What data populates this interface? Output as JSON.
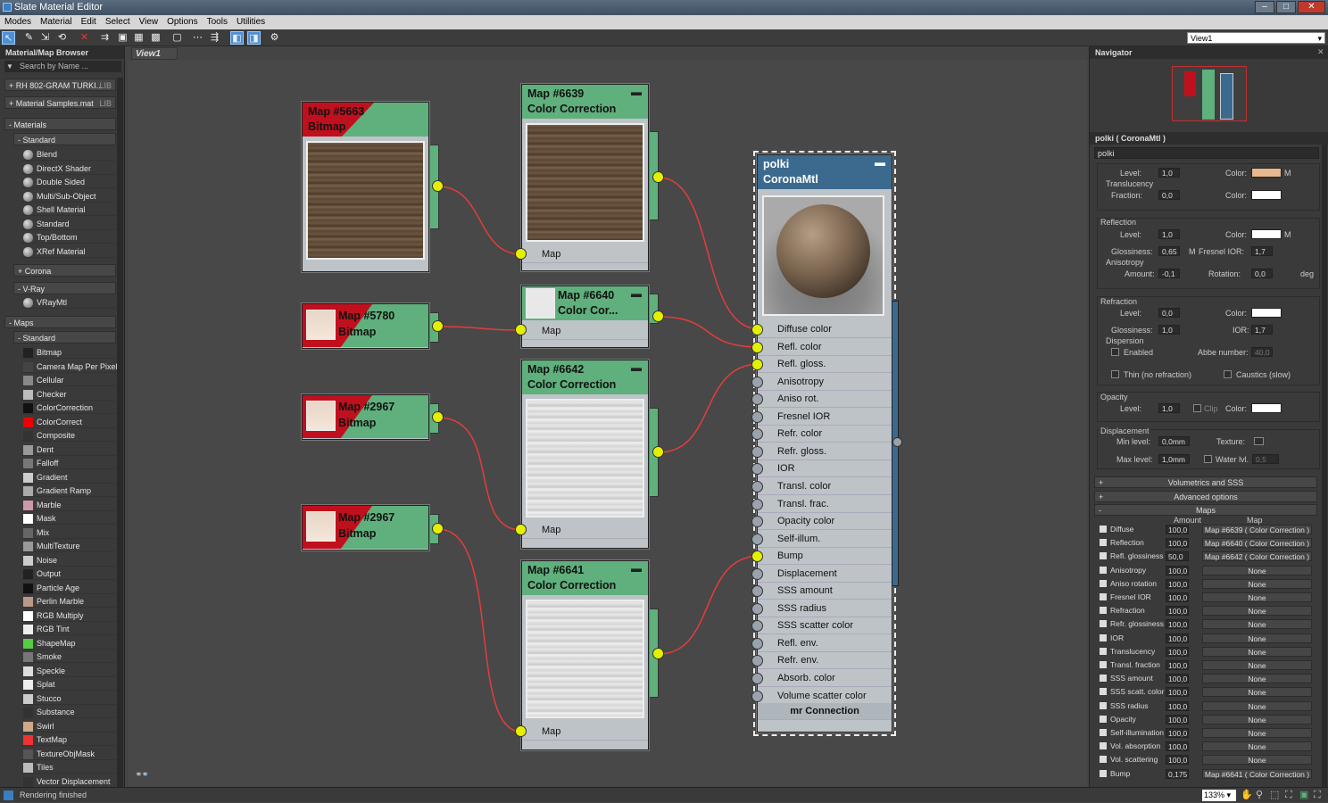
{
  "window": {
    "title": "Slate Material Editor"
  },
  "menu": [
    "Modes",
    "Material",
    "Edit",
    "Select",
    "View",
    "Options",
    "Tools",
    "Utilities"
  ],
  "view_select": "View1",
  "view_tab": "View1",
  "browser": {
    "title": "Material/Map Browser",
    "search_placeholder": "Search by Name ...",
    "libs": [
      {
        "label": "+ RH 802-GRAM TURKI...",
        "tag": "LIB"
      },
      {
        "label": "+ Material Samples.mat",
        "tag": "LIB"
      }
    ],
    "materials_header": "- Materials",
    "standard_header": "- Standard",
    "materials": [
      "Blend",
      "DirectX Shader",
      "Double Sided",
      "Multi/Sub-Object",
      "Shell Material",
      "Standard",
      "Top/Bottom",
      "XRef Material"
    ],
    "corona_header": "+ Corona",
    "vray_header": "- V-Ray",
    "vray_items": [
      "VRayMtl"
    ],
    "maps_header": "- Maps",
    "maps_standard_header": "- Standard",
    "maps": [
      "Bitmap",
      "Camera Map Per Pixel",
      "Cellular",
      "Checker",
      "ColorCorrection",
      "ColorCorrect",
      "Composite",
      "Dent",
      "Falloff",
      "Gradient",
      "Gradient Ramp",
      "Marble",
      "Mask",
      "Mix",
      "MultiTexture",
      "Noise",
      "Output",
      "Particle Age",
      "Perlin Marble",
      "RGB Multiply",
      "RGB Tint",
      "ShapeMap",
      "Smoke",
      "Speckle",
      "Splat",
      "Stucco",
      "Substance",
      "Swirl",
      "TextMap",
      "TextureObjMask",
      "Tiles",
      "Vector Displacement"
    ]
  },
  "nodes": {
    "n5663": {
      "line1": "Map #5663",
      "line2": "Bitmap"
    },
    "n5780": {
      "line1": "Map #5780",
      "line2": "Bitmap"
    },
    "n2967a": {
      "line1": "Map #2967",
      "line2": "Bitmap"
    },
    "n2967b": {
      "line1": "Map #2967",
      "line2": "Bitmap"
    },
    "n6639": {
      "line1": "Map #6639",
      "line2": "Color Correction",
      "slot": "Map"
    },
    "n6640": {
      "line1": "Map #6640",
      "line2": "Color Cor...",
      "slot": "Map"
    },
    "n6642": {
      "line1": "Map #6642",
      "line2": "Color Correction",
      "slot": "Map"
    },
    "n6641": {
      "line1": "Map #6641",
      "line2": "Color Correction",
      "slot": "Map"
    },
    "polki": {
      "line1": "polki",
      "line2": "CoronaMtl",
      "footer": "mr Connection",
      "slots": [
        "Diffuse color",
        "Refl. color",
        "Refl. gloss.",
        "Anisotropy",
        "Aniso rot.",
        "Fresnel IOR",
        "Refr. color",
        "Refr. gloss.",
        "IOR",
        "Transl. color",
        "Transl. frac.",
        "Opacity color",
        "Self-illum.",
        "Bump",
        "Displacement",
        "SSS amount",
        "SSS radius",
        "SSS scatter color",
        "Refl. env.",
        "Refr. env.",
        "Absorb. color",
        "Volume scatter color"
      ],
      "connected": [
        true,
        true,
        true,
        false,
        false,
        false,
        false,
        false,
        false,
        false,
        false,
        false,
        false,
        true,
        false,
        false,
        false,
        false,
        false,
        false,
        false,
        false
      ]
    }
  },
  "navigator": {
    "title": "Navigator"
  },
  "params": {
    "title": "polki  ( CoronaMtl )",
    "name": "polki",
    "level_label": "Level:",
    "level": "1,0",
    "color_label": "Color:",
    "m": "M",
    "translucency": "Translucency",
    "fraction_label": "Fraction:",
    "fraction": "0,0",
    "reflection": "Reflection",
    "refl_level": "1,0",
    "glossiness_label": "Glossiness:",
    "refl_gloss": "0,65",
    "fresnel_label": "Fresnel IOR:",
    "fresnel": "1,7",
    "anisotropy": "Anisotropy",
    "amount_label": "Amount:",
    "aniso_amount": "-0,1",
    "rotation_label": "Rotation:",
    "rotation": "0,0",
    "deg": "deg",
    "refraction": "Refraction",
    "refr_level": "0,0",
    "refr_gloss": "1,0",
    "ior_label": "IOR:",
    "ior": "1,7",
    "dispersion": "Dispersion",
    "enabled": "Enabled",
    "abbe_label": "Abbe number:",
    "abbe": "40,0",
    "thin": "Thin (no refraction)",
    "caustics": "Caustics (slow)",
    "opacity": "Opacity",
    "op_level": "1,0",
    "clip": "Clip",
    "displacement": "Displacement",
    "min_label": "Min level:",
    "min": "0,0mm",
    "texture_label": "Texture:",
    "max_label": "Max level:",
    "max": "1,0mm",
    "water_label": "Water lvl.",
    "water": "0,5",
    "vol": "Volumetrics and SSS",
    "adv": "Advanced options",
    "maps": "Maps",
    "amount_col": "Amount",
    "map_col": "Map",
    "colors": {
      "level_color": "#e7b98d",
      "white": "#ffffff"
    },
    "map_rows": [
      {
        "n": "Diffuse",
        "a": "100,0",
        "m": "Map #6639  ( Color Correction )"
      },
      {
        "n": "Reflection",
        "a": "100,0",
        "m": "Map #6640  ( Color Correction )"
      },
      {
        "n": "Refl. glossiness",
        "a": "50,0",
        "m": "Map #6642  ( Color Correction )"
      },
      {
        "n": "Anisotropy",
        "a": "100,0",
        "m": "None"
      },
      {
        "n": "Aniso rotation",
        "a": "100,0",
        "m": "None"
      },
      {
        "n": "Fresnel IOR",
        "a": "100,0",
        "m": "None"
      },
      {
        "n": "Refraction",
        "a": "100,0",
        "m": "None"
      },
      {
        "n": "Refr. glossiness",
        "a": "100,0",
        "m": "None"
      },
      {
        "n": "IOR",
        "a": "100,0",
        "m": "None"
      },
      {
        "n": "Translucency",
        "a": "100,0",
        "m": "None"
      },
      {
        "n": "Transl. fraction",
        "a": "100,0",
        "m": "None"
      },
      {
        "n": "SSS amount",
        "a": "100,0",
        "m": "None"
      },
      {
        "n": "SSS scatt. color",
        "a": "100,0",
        "m": "None"
      },
      {
        "n": "SSS radius",
        "a": "100,0",
        "m": "None"
      },
      {
        "n": "Opacity",
        "a": "100,0",
        "m": "None"
      },
      {
        "n": "Self-illumination",
        "a": "100,0",
        "m": "None"
      },
      {
        "n": "Vol. absorption",
        "a": "100,0",
        "m": "None"
      },
      {
        "n": "Vol. scattering",
        "a": "100,0",
        "m": "None"
      },
      {
        "n": "Bump",
        "a": "0,175",
        "m": "Map #6641  ( Color Correction )"
      }
    ]
  },
  "status": {
    "text": "Rendering finished",
    "zoom": "133%"
  }
}
